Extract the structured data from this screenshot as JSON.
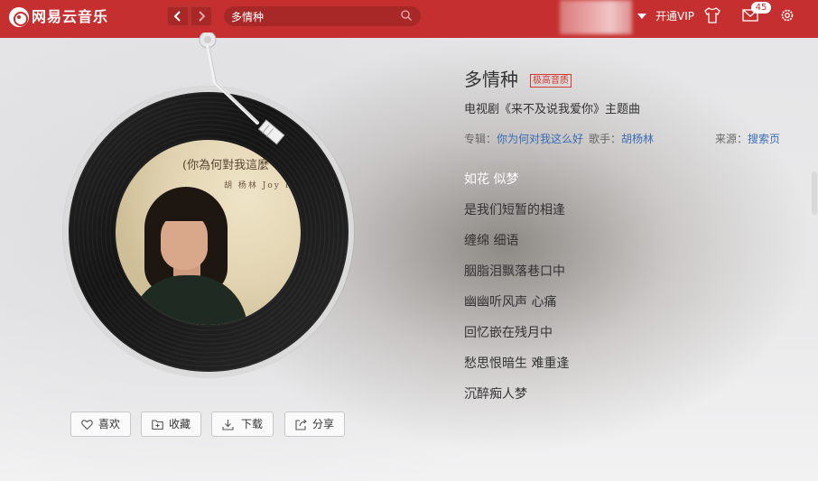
{
  "app": {
    "title": "网易云音乐",
    "accent": "#c62f2f"
  },
  "topbar": {
    "back_icon": "chevron-left-icon",
    "forward_icon": "chevron-right-icon",
    "search_value": "多情种",
    "search_icon": "search-icon",
    "vip_label": "开通VIP",
    "mail_badge": "45",
    "icons": [
      "skin-icon",
      "mail-icon",
      "gear-icon"
    ]
  },
  "song": {
    "title": "多情种",
    "quality": "极高音质",
    "subtitle": "电视剧《来不及说我爱你》主题曲",
    "album_label": "专辑：",
    "album": "你为何对我这么好",
    "artist_label": "歌手：",
    "artist": "胡杨林",
    "source_label": "来源：",
    "source": "搜索页"
  },
  "cover": {
    "title": "(你為何對我這麼",
    "subtitle": "胡 杨林 Joy  Hu"
  },
  "lyrics": [
    {
      "text": "如花 似梦",
      "current": true
    },
    {
      "text": "是我们短暂的相逢",
      "current": false
    },
    {
      "text": "缠绵 细语",
      "current": false
    },
    {
      "text": "胭脂泪飘落巷口中",
      "current": false
    },
    {
      "text": "幽幽听风声 心痛",
      "current": false
    },
    {
      "text": "回忆嵌在残月中",
      "current": false
    },
    {
      "text": "愁思恨暗生 难重逢",
      "current": false
    },
    {
      "text": "沉醉痴人梦",
      "current": false
    }
  ],
  "actions": {
    "like": "喜欢",
    "collect": "收藏",
    "download": "下载",
    "share": "分享"
  }
}
